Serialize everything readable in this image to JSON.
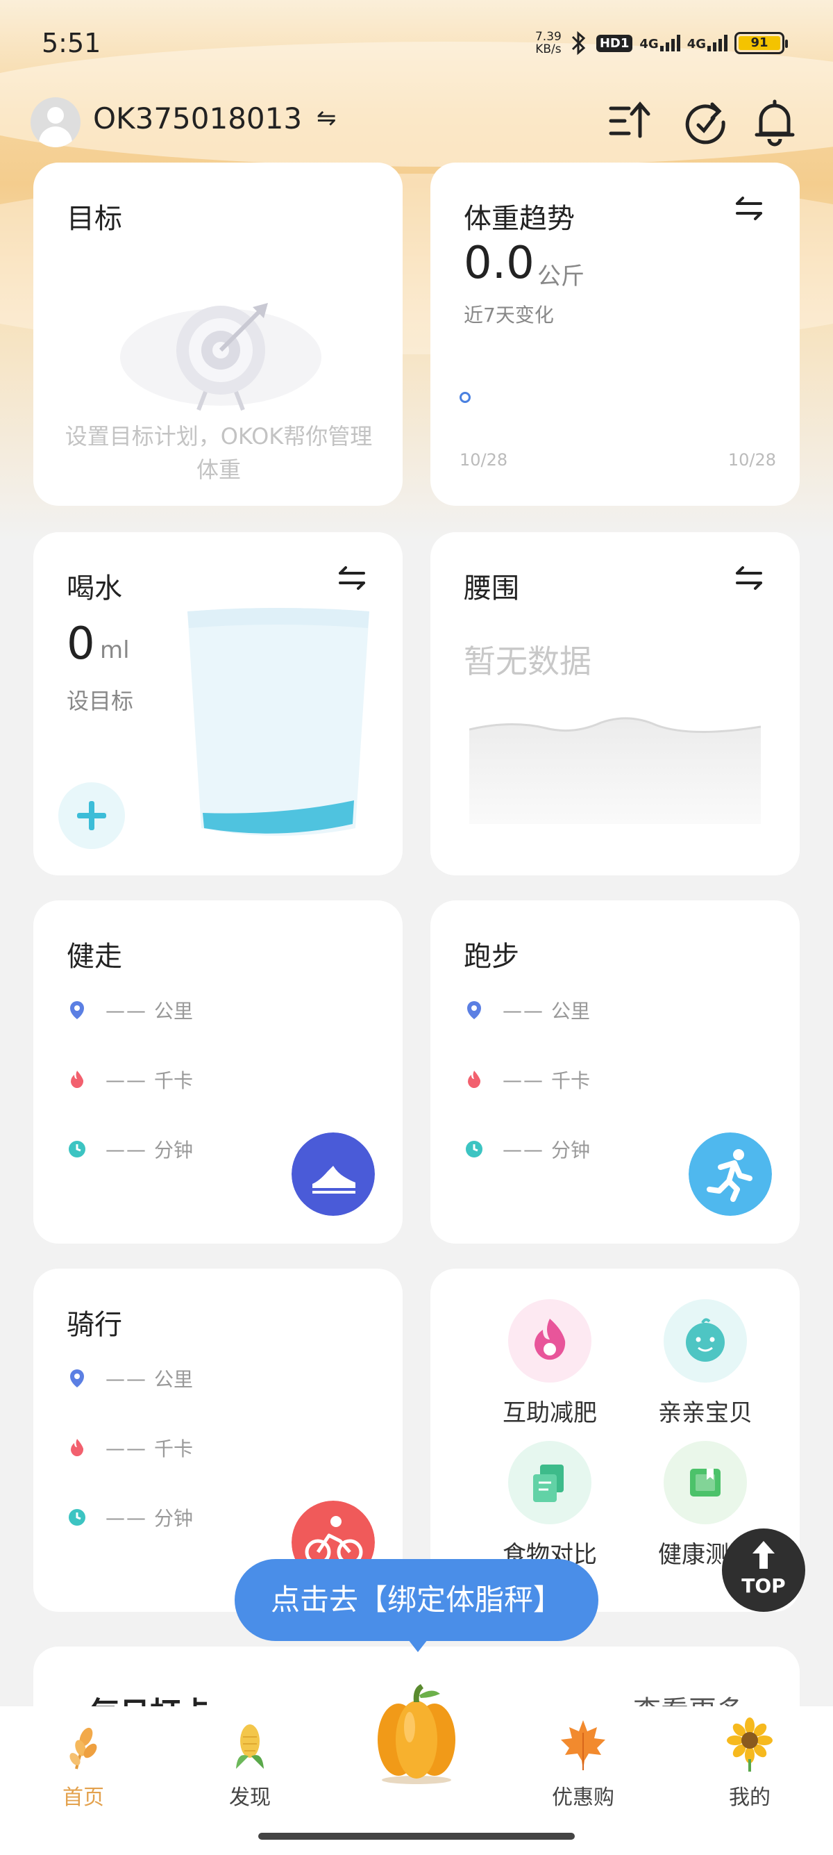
{
  "status_bar": {
    "time": "5:51",
    "net_speed_value": "7.39",
    "net_speed_unit": "KB/s",
    "hd_badge": "HD1",
    "signal1": "4G",
    "signal2": "4G",
    "battery": "91"
  },
  "header": {
    "username": "OK375018013",
    "swap_glyph": "⇋",
    "icons": [
      "sort-icon",
      "refresh-icon",
      "bell-icon"
    ]
  },
  "cards": {
    "target": {
      "title": "目标",
      "hint": "设置目标计划，OKOK帮你管理体重"
    },
    "weight": {
      "title": "体重趋势",
      "value": "0.0",
      "unit": "公斤",
      "sub": "近7天变化",
      "date_start": "10/28",
      "date_end": "10/28"
    },
    "water": {
      "title": "喝水",
      "value": "0",
      "unit": "ml",
      "goal": "设目标"
    },
    "waist": {
      "title": "腰围",
      "empty": "暂无数据"
    },
    "walk": {
      "title": "健走",
      "distance_value": "——",
      "distance_unit": "公里",
      "calorie_value": "——",
      "calorie_unit": "千卡",
      "time_value": "——",
      "time_unit": "分钟"
    },
    "run": {
      "title": "跑步",
      "distance_value": "——",
      "distance_unit": "公里",
      "calorie_value": "——",
      "calorie_unit": "千卡",
      "time_value": "——",
      "time_unit": "分钟"
    },
    "ride": {
      "title": "骑行",
      "distance_value": "——",
      "distance_unit": "公里",
      "calorie_value": "——",
      "calorie_unit": "千卡",
      "time_value": "——",
      "time_unit": "分钟"
    },
    "features": {
      "items": [
        {
          "label": "互助减肥",
          "icon": "flame-icon"
        },
        {
          "label": "亲亲宝贝",
          "icon": "baby-face-icon"
        },
        {
          "label": "食物对比",
          "icon": "food-compare-icon"
        },
        {
          "label": "健康测评",
          "icon": "health-book-icon"
        }
      ]
    }
  },
  "top_button": "TOP",
  "bind_prompt": "点击去【绑定体脂秤】",
  "bottom_card": {
    "title": "每日打卡",
    "more": "查看更多"
  },
  "tabs": [
    {
      "label": "首页",
      "icon": "wheat-icon"
    },
    {
      "label": "发现",
      "icon": "corn-icon"
    },
    {
      "label": "",
      "icon": "pumpkin-icon"
    },
    {
      "label": "优惠购",
      "icon": "maple-leaf-icon"
    },
    {
      "label": "我的",
      "icon": "sunflower-icon"
    }
  ],
  "colors": {
    "accent_blue": "#4a8ee8",
    "walk_button": "#4a5bd8",
    "run_button": "#4fb8ee",
    "ride_button": "#f05a5a",
    "active_tab": "#e3a14d"
  }
}
